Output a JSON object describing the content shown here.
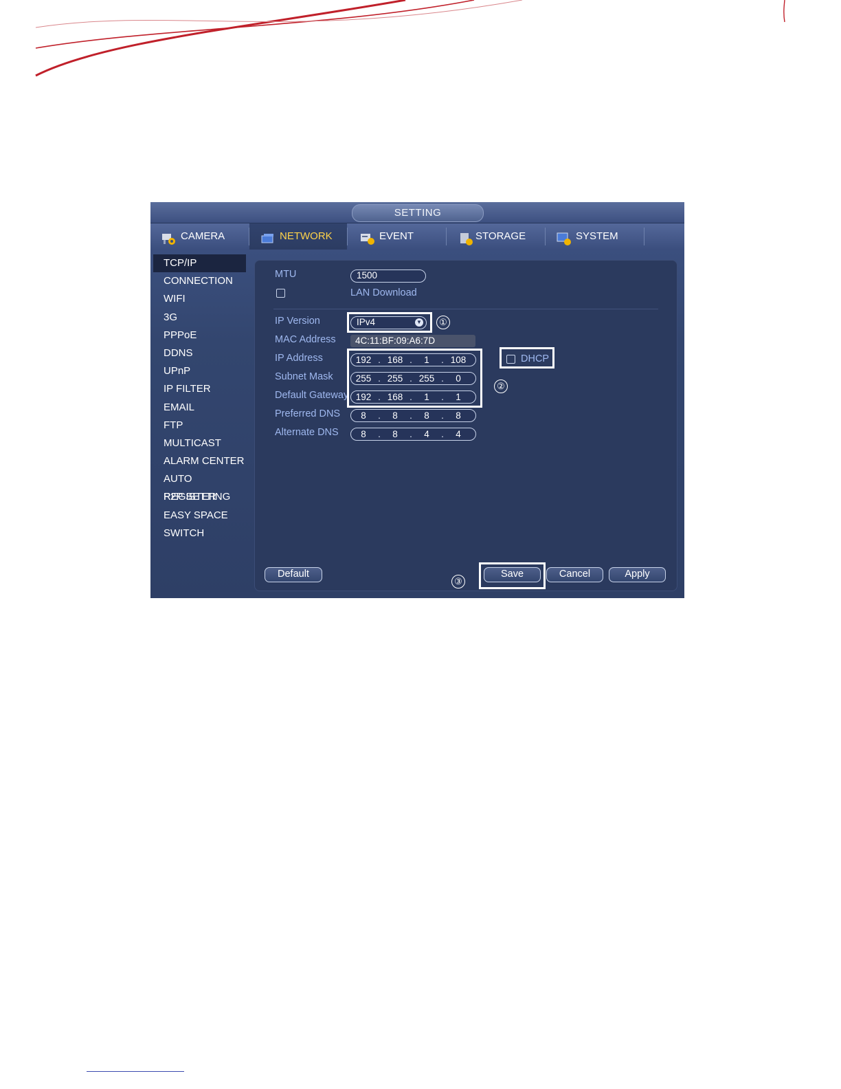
{
  "window": {
    "title": "SETTING"
  },
  "tabs": [
    {
      "label": "CAMERA",
      "icon": "camera-gear-icon"
    },
    {
      "label": "NETWORK",
      "icon": "network-icon",
      "active": true
    },
    {
      "label": "EVENT",
      "icon": "event-icon"
    },
    {
      "label": "STORAGE",
      "icon": "storage-icon"
    },
    {
      "label": "SYSTEM",
      "icon": "system-icon"
    }
  ],
  "menu": {
    "items": [
      "TCP/IP",
      "CONNECTION",
      "WIFI",
      "3G",
      "PPPoE",
      "DDNS",
      "UPnP",
      "IP FILTER",
      "EMAIL",
      "FTP",
      "MULTICAST",
      "ALARM CENTER",
      "AUTO REGISTER",
      "P2P SETTING",
      "EASY SPACE",
      "SWITCH"
    ],
    "active_index": 0
  },
  "form": {
    "mtu_label": "MTU",
    "mtu_value": "1500",
    "lan_download_label": "LAN Download",
    "lan_download_checked": false,
    "ip_version_label": "IP Version",
    "ip_version_value": "IPv4",
    "mac_label": "MAC Address",
    "mac_value": "4C:11:BF:09:A6:7D",
    "ip_label": "IP Address",
    "ip": [
      "192",
      "168",
      "1",
      "108"
    ],
    "subnet_label": "Subnet Mask",
    "subnet": [
      "255",
      "255",
      "255",
      "0"
    ],
    "gateway_label": "Default Gateway",
    "gateway": [
      "192",
      "168",
      "1",
      "1"
    ],
    "dns1_label": "Preferred DNS",
    "dns1": [
      "8",
      "8",
      "8",
      "8"
    ],
    "dns2_label": "Alternate DNS",
    "dns2": [
      "8",
      "8",
      "4",
      "4"
    ],
    "dhcp_label": "DHCP",
    "dhcp_checked": false
  },
  "buttons": {
    "default": "Default",
    "save": "Save",
    "cancel": "Cancel",
    "apply": "Apply"
  },
  "callouts": [
    "①",
    "②",
    "③"
  ],
  "colors": {
    "accent_red": "#c0202a",
    "active_tab_text": "#ffd34a",
    "label_blue": "#9fb8ef"
  }
}
